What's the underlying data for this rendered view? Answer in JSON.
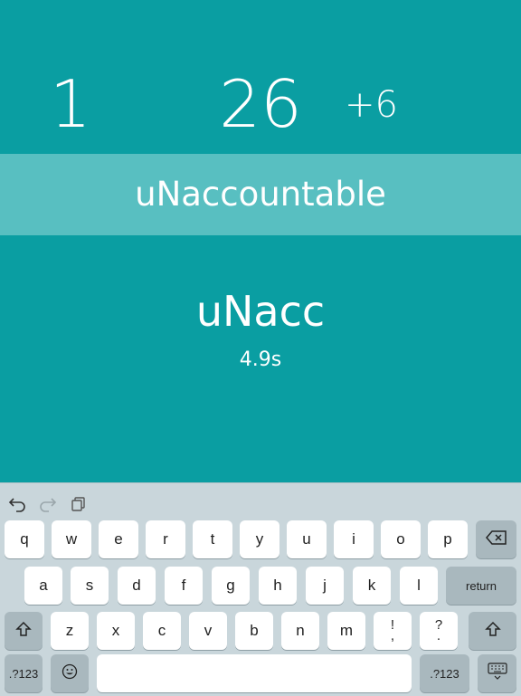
{
  "game": {
    "level": "1",
    "score": "26",
    "bonus": "+6",
    "target_word": "uNaccountable",
    "typed_text": "uNacc",
    "timer": "4.9s"
  },
  "keyboard": {
    "toolbar": {
      "undo_icon": "undo-icon",
      "redo_icon": "redo-icon",
      "paste_icon": "clipboard-icon"
    },
    "row1": [
      "q",
      "w",
      "e",
      "r",
      "t",
      "y",
      "u",
      "i",
      "o",
      "p"
    ],
    "row2": [
      "a",
      "s",
      "d",
      "f",
      "g",
      "h",
      "j",
      "k",
      "l"
    ],
    "row3": [
      "z",
      "x",
      "c",
      "v",
      "b",
      "n",
      "m"
    ],
    "punct_left_top": "!",
    "punct_left_bottom": ",",
    "punct_right_top": "?",
    "punct_right_bottom": ".",
    "return_label": "return",
    "numbers_label": ".?123",
    "colors": {
      "background": "#c9d6db",
      "key": "#ffffff",
      "special_key": "#a9b8be"
    }
  },
  "colors": {
    "accent": "#0a9ea2",
    "band": "#58bfc1"
  }
}
